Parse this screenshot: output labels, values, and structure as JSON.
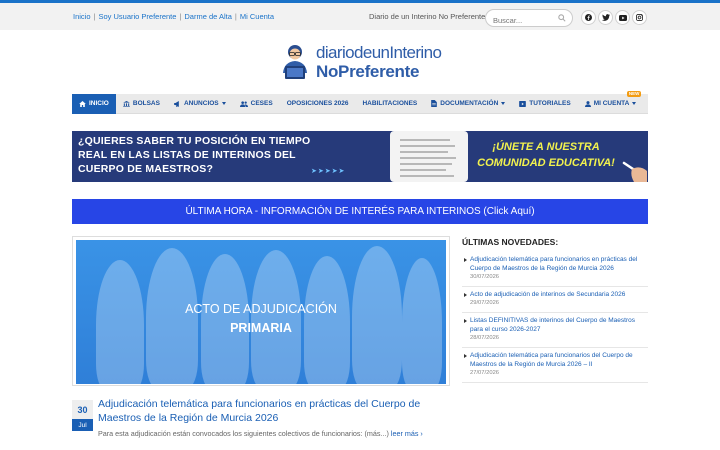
{
  "topbar": {
    "links": [
      "Inicio",
      "Soy Usuario Preferente",
      "Darme de Alta",
      "Mi Cuenta"
    ],
    "tagline": "Diario de un Interino No Preferente.",
    "search_placeholder": "Buscar...",
    "social": [
      "facebook-icon",
      "twitter-icon",
      "youtube-icon",
      "instagram-icon"
    ]
  },
  "logo": {
    "line1": "diariodeunInterino",
    "line2": "NoPreferente"
  },
  "nav": {
    "items": [
      {
        "label": "INICIO",
        "icon": "home-icon",
        "active": true,
        "dropdown": false
      },
      {
        "label": "BOLSAS",
        "icon": "bank-icon",
        "dropdown": false
      },
      {
        "label": "ANUNCIOS",
        "icon": "megaphone-icon",
        "dropdown": true
      },
      {
        "label": "CESES",
        "icon": "users-icon",
        "dropdown": false
      },
      {
        "label": "OPOSICIONES 2026",
        "icon": "",
        "dropdown": false
      },
      {
        "label": "HABILITACIONES",
        "icon": "",
        "dropdown": false
      },
      {
        "label": "DOCUMENTACIÓN",
        "icon": "document-icon",
        "dropdown": true
      },
      {
        "label": "TUTORIALES",
        "icon": "video-icon",
        "dropdown": false
      },
      {
        "label": "MI CUENTA",
        "icon": "user-icon",
        "dropdown": true,
        "badge": "NEW"
      }
    ],
    "active_color": "#1a5fb4"
  },
  "banner": {
    "text": "¿QUIERES SABER TU POSICIÓN EN TIEMPO REAL EN LAS LISTAS DE INTERINOS DEL CUERPO DE MAESTROS?",
    "cta": "¡ÚNETE A NUESTRA COMUNIDAD EDUCATIVA!",
    "bg_color": "#263a7a"
  },
  "ultima_hora": {
    "label": "ÚLTIMA HORA - INFORMACIÓN DE INTERÉS PARA INTERINOS (Click Aquí)",
    "bg_color": "#2745e6"
  },
  "featured": {
    "line1": "ACTO DE ADJUDICACIÓN",
    "line2": "PRIMARIA"
  },
  "post": {
    "day": "30",
    "month": "Jul",
    "title": "Adjudicación telemática para funcionarios en prácticas del Cuerpo de Maestros de la Región de Murcia 2026",
    "excerpt": "Para esta adjudicación están convocados los siguientes colectivos de funcionarios: (más...)",
    "read_more": "leer más"
  },
  "sidebar": {
    "title": "ÚLTIMAS NOVEDADES:",
    "items": [
      {
        "title": "Adjudicación telemática para funcionarios en prácticas del Cuerpo de Maestros de la Región de Murcia 2026",
        "date": "30/07/2026"
      },
      {
        "title": "Acto de adjudicación de interinos de Secundaria 2026",
        "date": "29/07/2026"
      },
      {
        "title": "Listas DEFINITIVAS de interinos del Cuerpo de Maestros para el curso 2026-2027",
        "date": "28/07/2026"
      },
      {
        "title": "Adjudicación telemática para funcionarios del Cuerpo de Maestros de la Región de Murcia 2026 – II",
        "date": "27/07/2026"
      }
    ]
  }
}
